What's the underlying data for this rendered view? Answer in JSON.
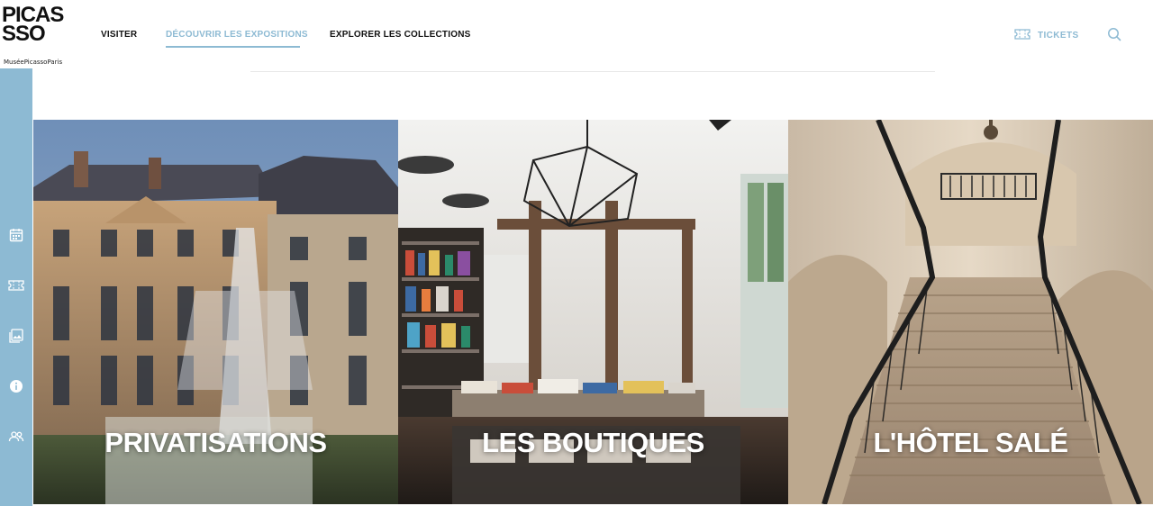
{
  "logo": {
    "mark_lines": [
      "PICAS",
      "SSO"
    ],
    "subtitle": "MuséePicassoParis"
  },
  "nav": {
    "items": [
      {
        "label": "VISITER",
        "active": false
      },
      {
        "label": "DÉCOUVRIR LES EXPOSITIONS",
        "active": true
      },
      {
        "label": "EXPLORER LES COLLECTIONS",
        "active": false
      }
    ]
  },
  "header_actions": {
    "tickets_label": "TICKETS",
    "tickets_icon": "ticket-icon",
    "search_icon": "search-icon"
  },
  "sidebar": {
    "icons": [
      "calendar-icon",
      "ticket-icon",
      "gallery-icon",
      "info-icon",
      "group-icon"
    ]
  },
  "panels": [
    {
      "title": "PRIVATISATIONS",
      "scene": "chateau facade with champagne glass tower"
    },
    {
      "title": "LES BOUTIQUES",
      "scene": "bookshop interior with geometric pendant lights"
    },
    {
      "title": "L'HÔTEL SALÉ",
      "scene": "grand stone staircase with wrought iron railings"
    }
  ],
  "colors": {
    "accent": "#8dbad3",
    "sidebar": "#8dbad3",
    "text": "#111111"
  }
}
